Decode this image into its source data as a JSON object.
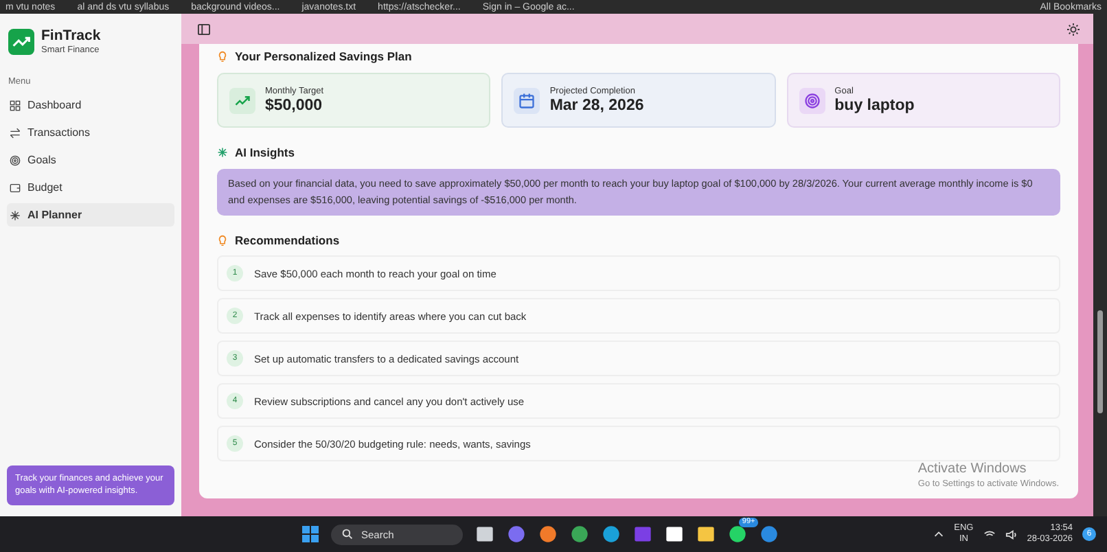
{
  "bookmarks": [
    {
      "label": "m vtu notes"
    },
    {
      "label": "al and ds vtu syllabus"
    },
    {
      "label": "background videos..."
    },
    {
      "label": "javanotes.txt"
    },
    {
      "label": "https://atschecker..."
    },
    {
      "label": "Sign in – Google ac..."
    }
  ],
  "all_bookmarks": "All Bookmarks",
  "sidebar": {
    "brand": "FinTrack",
    "subtitle": "Smart Finance",
    "menu_label": "Menu",
    "items": [
      {
        "label": "Dashboard",
        "kind": "grid",
        "selected": false
      },
      {
        "label": "Transactions",
        "kind": "arrows",
        "selected": false
      },
      {
        "label": "Goals",
        "kind": "target",
        "selected": false
      },
      {
        "label": "Budget",
        "kind": "wallet",
        "selected": false
      },
      {
        "label": "AI Planner",
        "kind": "sparkle",
        "selected": true
      }
    ],
    "promo": "Track your finances and achieve your goals with AI-powered insights."
  },
  "plan": {
    "title": "Your Personalized Savings Plan",
    "stats": [
      {
        "label": "Monthly Target",
        "value": "$50,000",
        "kind": "trend"
      },
      {
        "label": "Projected Completion",
        "value": "Mar 28, 2026",
        "kind": "calendar"
      },
      {
        "label": "Goal",
        "value": "buy laptop",
        "kind": "target"
      }
    ],
    "insights_title": "AI Insights",
    "insights_text": "Based on your financial data, you need to save approximately $50,000 per month to reach your buy laptop goal of $100,000 by 28/3/2026. Your current average monthly income is $0 and expenses are $516,000, leaving potential savings of -$516,000 per month.",
    "recommendations_title": "Recommendations",
    "recommendations": [
      {
        "number": "1",
        "text": "Save $50,000 each month to reach your goal on time"
      },
      {
        "number": "2",
        "text": "Track all expenses to identify areas where you can cut back"
      },
      {
        "number": "3",
        "text": "Set up automatic transfers to a dedicated savings account"
      },
      {
        "number": "4",
        "text": "Review subscriptions and cancel any you don't actively use"
      },
      {
        "number": "5",
        "text": "Consider the 50/30/20 budgeting rule: needs, wants, savings"
      }
    ]
  },
  "activation": {
    "title": "Activate Windows",
    "subtitle": "Go to Settings to activate Windows."
  },
  "taskbar": {
    "search": "Search",
    "apps": [
      {
        "kind": "files"
      },
      {
        "kind": "meet"
      },
      {
        "kind": "firefox"
      },
      {
        "kind": "chrome"
      },
      {
        "kind": "edge"
      },
      {
        "kind": "ide"
      },
      {
        "kind": "xm"
      },
      {
        "kind": "folder"
      },
      {
        "kind": "whatsapp"
      },
      {
        "kind": "vscode"
      }
    ],
    "badge": "99+",
    "lang": "ENG",
    "region": "IN",
    "time": "13:54",
    "date": "28-03-2026",
    "notifications": "6"
  }
}
